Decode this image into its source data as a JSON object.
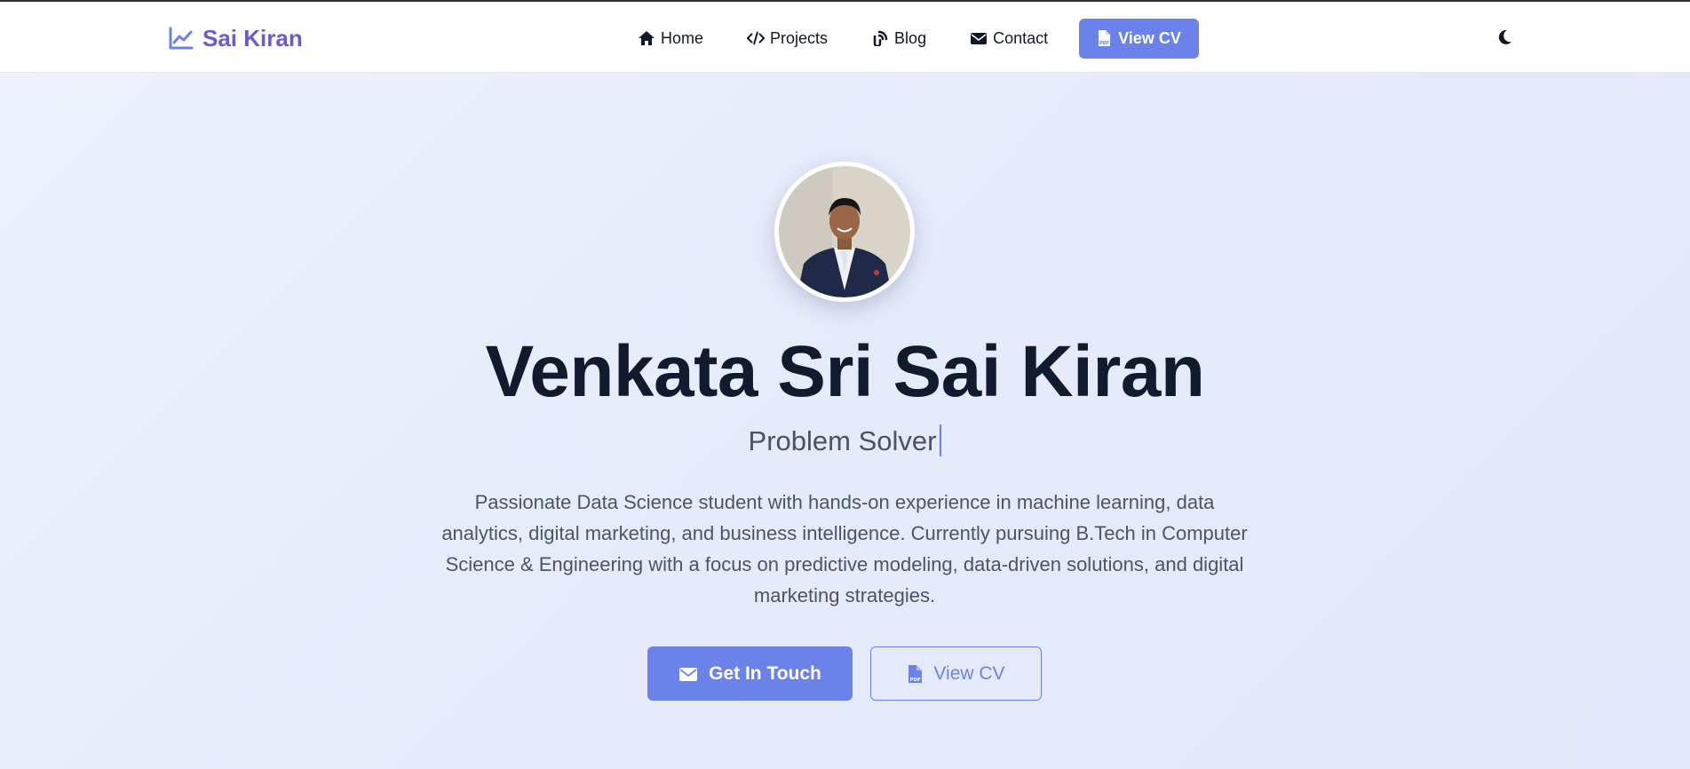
{
  "brand": {
    "name": "Sai Kiran",
    "icon": "chart-line-icon",
    "color": "#6a5ad6"
  },
  "nav": {
    "items": [
      {
        "label": "Home",
        "icon": "home-icon"
      },
      {
        "label": "Projects",
        "icon": "code-icon"
      },
      {
        "label": "Blog",
        "icon": "blog-icon"
      },
      {
        "label": "Contact",
        "icon": "envelope-icon"
      }
    ],
    "cv_button": {
      "label": "View CV",
      "icon": "file-pdf-icon"
    },
    "theme_toggle_icon": "moon-icon"
  },
  "hero": {
    "name": "Venkata Sri Sai Kiran",
    "role": "Problem Solver",
    "bio": "Passionate Data Science student with hands-on experience in machine learning, data analytics, digital marketing, and business intelligence. Currently pursuing B.Tech in Computer Science & Engineering with a focus on predictive modeling, data-driven solutions, and digital marketing strategies.",
    "primary_button": {
      "label": "Get In Touch",
      "icon": "envelope-icon"
    },
    "secondary_button": {
      "label": "View CV",
      "icon": "file-pdf-icon"
    }
  },
  "colors": {
    "accent": "#6b82ea",
    "heading": "#111a2e",
    "body_text": "#4b5563"
  }
}
